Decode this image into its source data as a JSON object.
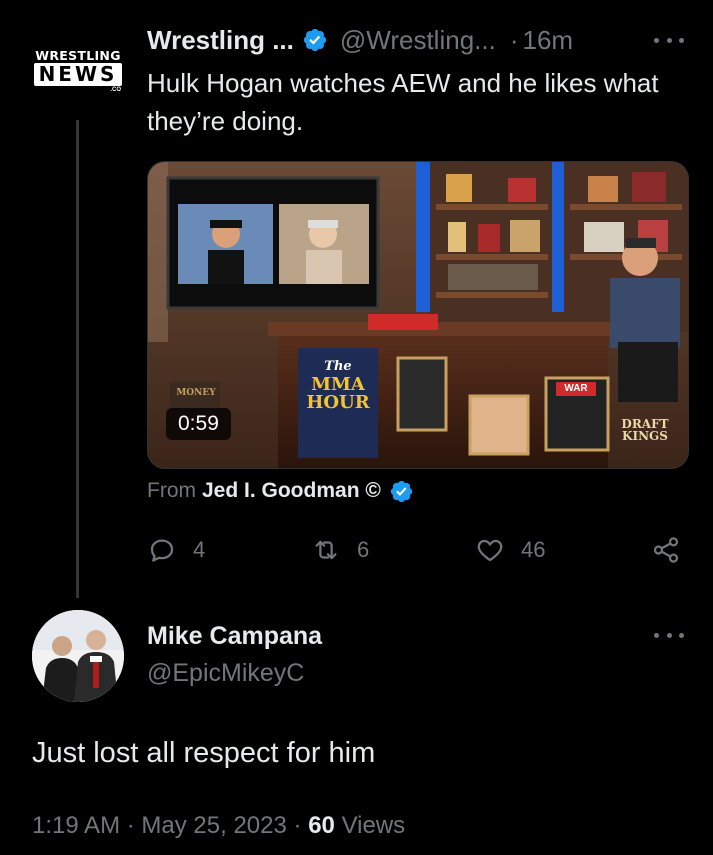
{
  "tweet": {
    "author_name": "Wrestling ...",
    "author_handle": "@Wrestling...",
    "separator": "·",
    "time": "16m",
    "text": "Hulk Hogan watches AEW and he likes what they’re doing.",
    "avatar_logo": {
      "top": "WRESTLING",
      "bottom": "NEWS",
      "suffix": ".CO"
    },
    "video": {
      "duration": "0:59",
      "show_title": [
        "The",
        "MMA",
        "HOUR"
      ],
      "sponsor": [
        "DRAFT",
        "KINGS"
      ],
      "badge": "WAR",
      "sign": "MONEY"
    },
    "attribution": {
      "label": "From",
      "name": "Jed I. Goodman ©"
    },
    "actions": {
      "replies": "4",
      "retweets": "6",
      "likes": "46"
    }
  },
  "reply": {
    "author_name": "Mike Campana",
    "author_handle": "@EpicMikeyC",
    "text": "Just lost all respect for him",
    "time": "1:19 AM",
    "date": "May 25, 2023",
    "separator": "·",
    "views_count": "60",
    "views_label": "Views"
  },
  "colors": {
    "background": "#000000",
    "text_primary": "#e7e9ea",
    "text_secondary": "#71767b",
    "verified_blue": "#1d9bf0",
    "border": "#2f3336"
  },
  "icons": [
    "verified-badge-icon",
    "more-icon",
    "reply-icon",
    "retweet-icon",
    "like-icon",
    "share-icon"
  ]
}
